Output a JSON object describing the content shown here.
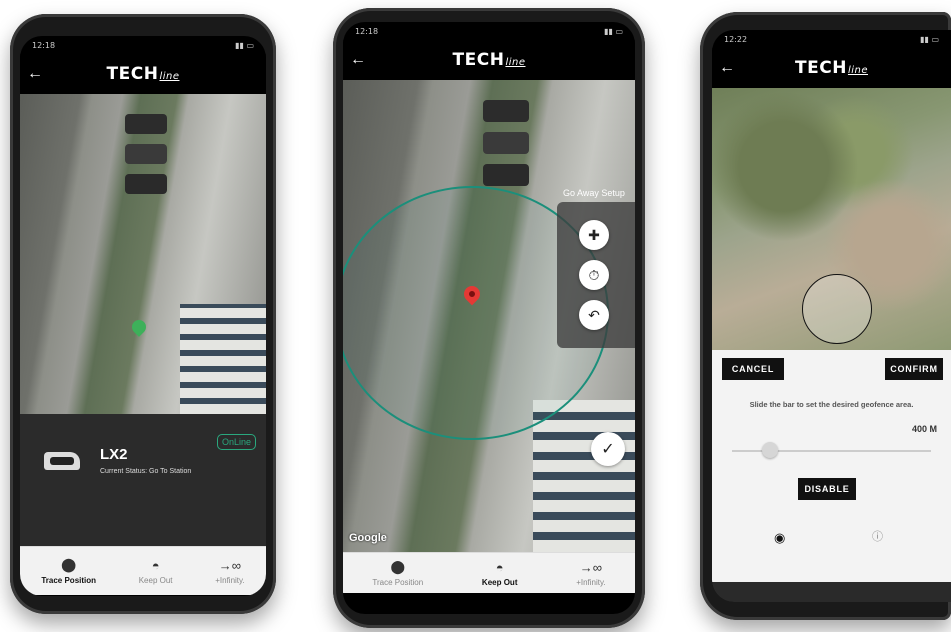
{
  "logo": {
    "main": "TECH",
    "sub": "line"
  },
  "phone1": {
    "status_time": "12:18",
    "device_name": "LX2",
    "device_status": "Current Status: Go To Station",
    "online_badge": "OnLine",
    "nav": [
      {
        "label": "Trace Position",
        "icon": "location-pin-icon",
        "active": true
      },
      {
        "label": "Keep Out",
        "icon": "keep-out-icon",
        "active": false
      },
      {
        "label": "+Infinity.",
        "icon": "infinity-icon",
        "active": false
      }
    ]
  },
  "phone2": {
    "status_time": "12:18",
    "panel_title": "Go Away Setup",
    "google_label": "Google",
    "nav": [
      {
        "label": "Trace Position",
        "icon": "location-pin-icon",
        "active": false
      },
      {
        "label": "Keep Out",
        "icon": "keep-out-icon",
        "active": true
      },
      {
        "label": "+Infinity.",
        "icon": "infinity-icon",
        "active": false
      }
    ]
  },
  "phone3": {
    "status_time": "12:22",
    "cancel_label": "CANCEL",
    "confirm_label": "CONFIRM",
    "hint": "Slide the bar to set the desired geofence area.",
    "distance": "400 M",
    "disable_label": "DISABLE"
  },
  "colors": {
    "accent": "#2aa87e",
    "pin": "#e53935",
    "geofence": "#1b8f7b"
  }
}
